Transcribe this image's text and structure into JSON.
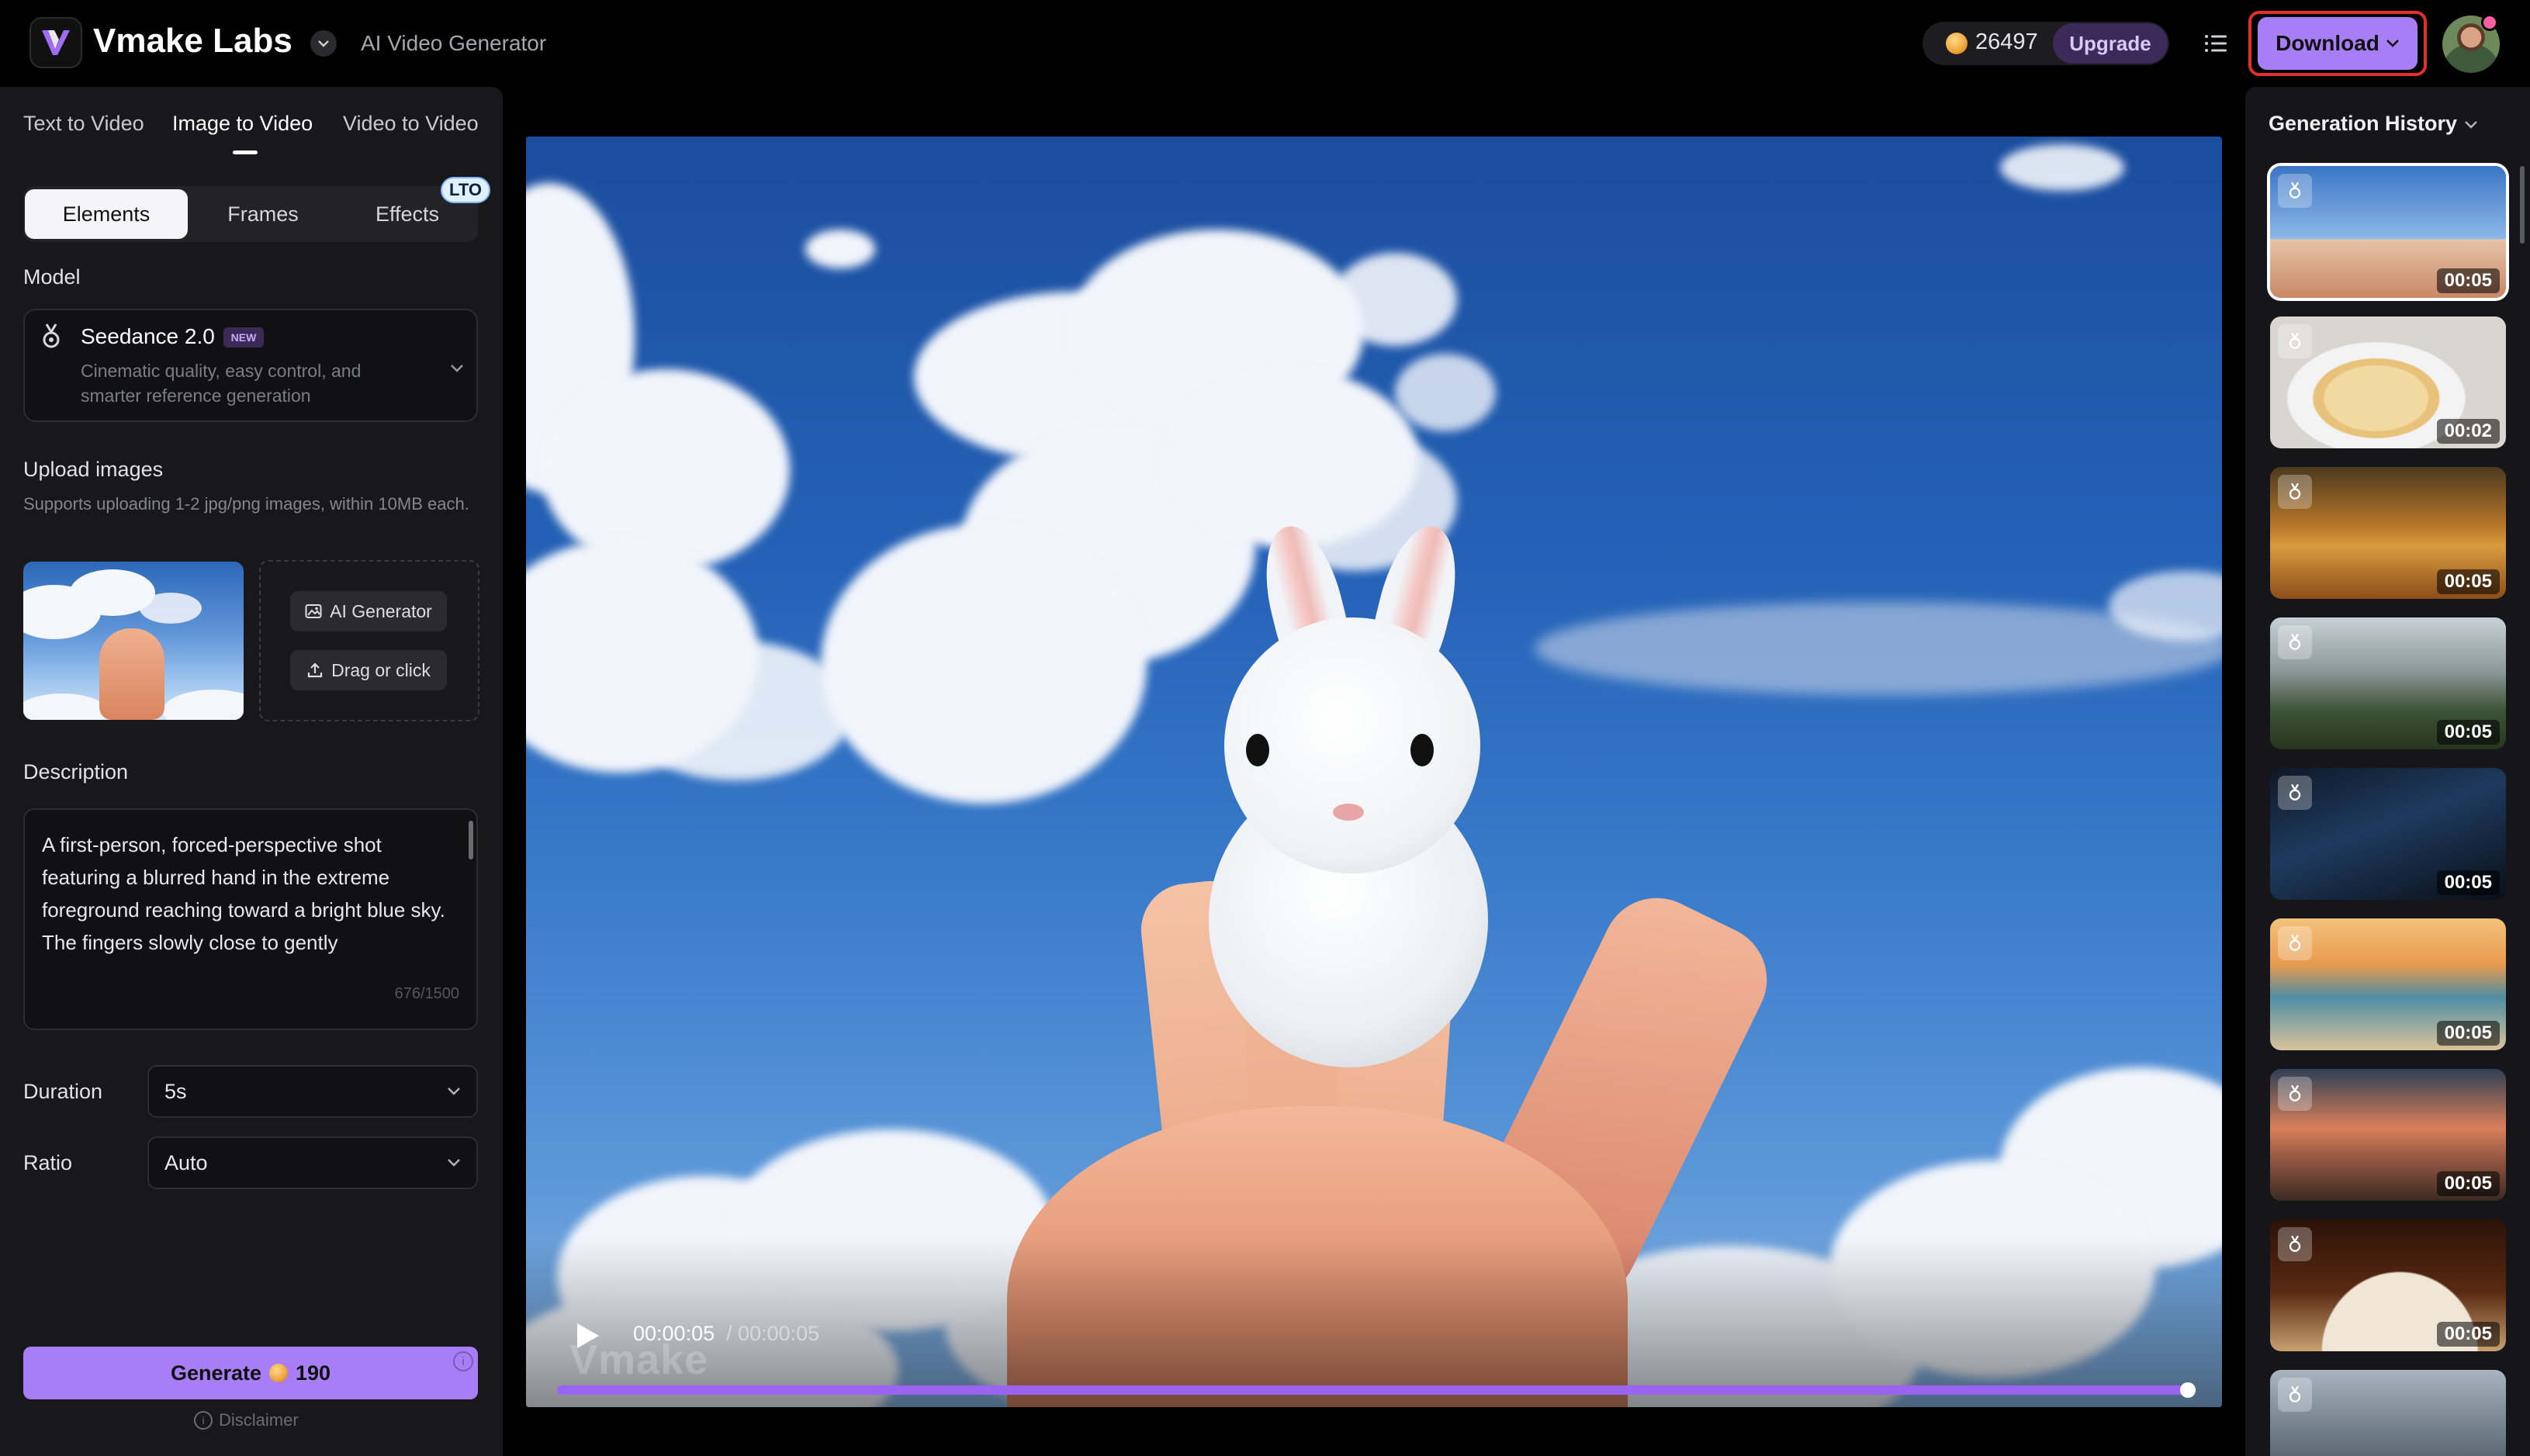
{
  "header": {
    "brand": "Vmake Labs",
    "app_name": "AI Video Generator",
    "credits": "26497",
    "upgrade_label": "Upgrade",
    "download_label": "Download"
  },
  "left_panel": {
    "mode_tabs": [
      "Text to Video",
      "Image to Video",
      "Video to Video"
    ],
    "active_mode": "Image to Video",
    "sub_tabs": [
      "Elements",
      "Frames",
      "Effects"
    ],
    "active_sub_tab": "Elements",
    "lto_badge": "LTO",
    "model_label": "Model",
    "model": {
      "name": "Seedance 2.0",
      "badge": "NEW",
      "description": "Cinematic quality, easy control, and smarter reference generation"
    },
    "upload": {
      "label": "Upload images",
      "hint": "Supports uploading 1-2 jpg/png images, within 10MB each.",
      "ai_generator_label": "AI Generator",
      "drag_label": "Drag or click"
    },
    "description": {
      "label": "Description",
      "text": "A first-person, forced-perspective shot featuring a blurred hand in the extreme foreground reaching toward a bright blue sky. The fingers slowly close to gently",
      "char_count": "676/1500"
    },
    "duration": {
      "label": "Duration",
      "value": "5s"
    },
    "ratio": {
      "label": "Ratio",
      "value": "Auto"
    },
    "generate": {
      "label": "Generate",
      "cost": "190"
    },
    "disclaimer": "Disclaimer"
  },
  "player": {
    "current_time": "00:00:05",
    "total_time": "/ 00:00:05",
    "watermark": "Vmake",
    "progress": 1.0
  },
  "history": {
    "title": "Generation History",
    "items": [
      {
        "duration": "00:05",
        "selected": true
      },
      {
        "duration": "00:02",
        "selected": false
      },
      {
        "duration": "00:05",
        "selected": false
      },
      {
        "duration": "00:05",
        "selected": false
      },
      {
        "duration": "00:05",
        "selected": false
      },
      {
        "duration": "00:05",
        "selected": false
      },
      {
        "duration": "00:05",
        "selected": false
      },
      {
        "duration": "00:05",
        "selected": false
      },
      {
        "duration": "",
        "selected": false
      }
    ]
  },
  "colors": {
    "accent": "#a87ef7",
    "download_highlight": "#e2312c",
    "progress": "#9a63f0",
    "panel": "#18181b"
  },
  "icons": [
    "vmake-logo-icon",
    "chevron-down-icon",
    "coin-icon",
    "menu-list-icon",
    "image-icon",
    "upload-icon",
    "play-icon",
    "info-icon",
    "seedance-model-icon"
  ]
}
